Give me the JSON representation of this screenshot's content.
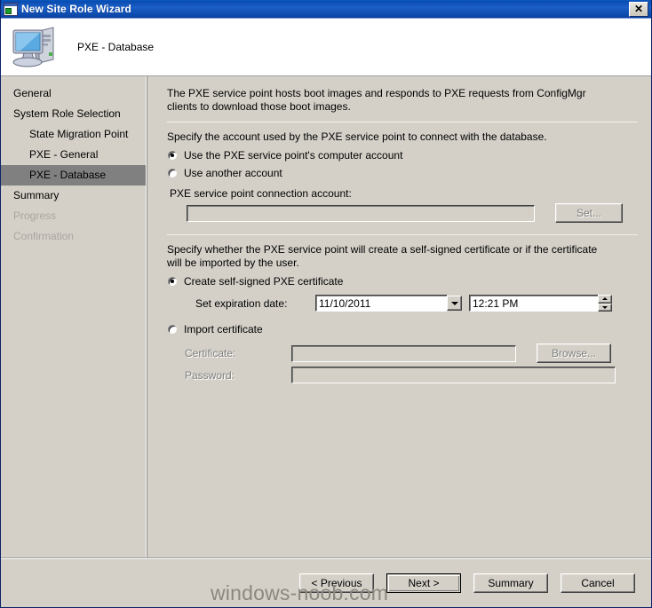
{
  "window": {
    "title": "New Site Role Wizard",
    "close_label": "✕",
    "icon": "wizard-window-icon"
  },
  "header": {
    "title": "PXE - Database",
    "icon": "computer-icon"
  },
  "sidebar": {
    "items": [
      {
        "label": "General",
        "indent": false,
        "selected": false,
        "disabled": false
      },
      {
        "label": "System Role Selection",
        "indent": false,
        "selected": false,
        "disabled": false
      },
      {
        "label": "State Migration Point",
        "indent": true,
        "selected": false,
        "disabled": false
      },
      {
        "label": "PXE - General",
        "indent": true,
        "selected": false,
        "disabled": false
      },
      {
        "label": "PXE - Database",
        "indent": true,
        "selected": true,
        "disabled": false
      },
      {
        "label": "Summary",
        "indent": false,
        "selected": false,
        "disabled": false
      },
      {
        "label": "Progress",
        "indent": false,
        "selected": false,
        "disabled": true
      },
      {
        "label": "Confirmation",
        "indent": false,
        "selected": false,
        "disabled": true
      }
    ]
  },
  "content": {
    "intro": "The PXE service point hosts boot images and responds to PXE requests from ConfigMgr clients to download those boot images.",
    "account_section": {
      "instruction": "Specify the account used by the PXE service point to connect with the database.",
      "radio_computer_account": "Use the PXE service point's computer account",
      "radio_another_account": "Use another account",
      "connection_account_label": "PXE service point connection account:",
      "connection_account_value": "",
      "set_button": "Set..."
    },
    "certificate_section": {
      "instruction": "Specify whether the PXE service point will create a self-signed certificate or if the certificate will be imported by the user.",
      "radio_self_signed": "Create self-signed PXE certificate",
      "expiration_label": "Set expiration date:",
      "expiration_date": "11/10/2011",
      "expiration_time": "12:21 PM",
      "radio_import": "Import certificate",
      "certificate_label": "Certificate:",
      "certificate_value": "",
      "browse_button": "Browse...",
      "password_label": "Password:",
      "password_value": ""
    }
  },
  "footer": {
    "previous_button": "< Previous",
    "next_button": "Next >",
    "summary_button": "Summary",
    "cancel_button": "Cancel"
  },
  "watermark": "windows-noob.com"
}
